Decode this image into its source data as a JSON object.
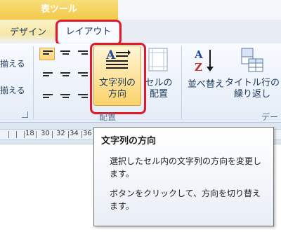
{
  "context_tab_group": "表ツール",
  "tabs": [
    {
      "label": "デザイン",
      "selected": false
    },
    {
      "label": "レイアウト",
      "selected": true
    }
  ],
  "ribbon": {
    "left_cmds": [
      "揃える",
      "揃える"
    ],
    "text_direction_label_line1": "文字列の",
    "text_direction_label_line2": "方向",
    "cell_margins_label_line1": "セルの",
    "cell_margins_label_line2": "配置",
    "alignment_group_label": "配置",
    "sort_label": "並べ替え",
    "repeat_header_label_line1": "タイトル行の",
    "repeat_header_label_line2": "繰り返し",
    "data_group_label_partial": "デー"
  },
  "ruler": {
    "numbers": [
      "18",
      "30",
      "32",
      "34",
      "36",
      "38"
    ]
  },
  "tooltip": {
    "title": "文字列の方向",
    "description": "選択したセル内の文字列の方向を変更します。",
    "hint": "ボタンをクリックして、方向を切り替えます。"
  },
  "colors": {
    "context_header": "#f2c94a",
    "highlight_border": "#e0192b",
    "button_hover": "#fde29b"
  }
}
